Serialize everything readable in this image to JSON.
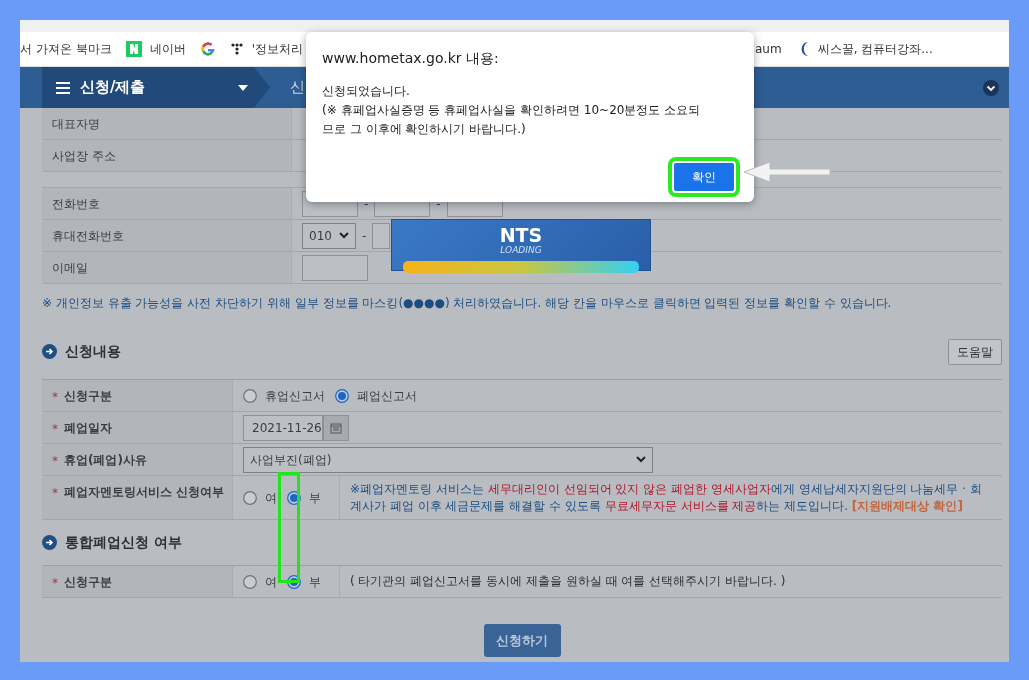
{
  "bookmarks_left": [
    {
      "kind": "text",
      "label": "서 가져온 북마크"
    },
    {
      "kind": "naver",
      "label": "네이버"
    },
    {
      "kind": "google"
    },
    {
      "kind": "dots",
      "label": "'정보처리"
    }
  ],
  "bookmarks_right": [
    {
      "kind": "text",
      "label": "aum"
    },
    {
      "kind": "crescent",
      "label": "씨스꿀, 컴퓨터강좌..."
    }
  ],
  "menu": {
    "title": "신청/제출",
    "breadcrumb": "신"
  },
  "dialog": {
    "title": "www.hometax.go.kr 내용:",
    "lines": [
      "신청되었습니다.",
      "(※ 휴페업사실증명 등 휴페업사실을 확인하려면 10~20분정도 소요되",
      "므로 그 이후에 확인하시기 바랍니다.)"
    ],
    "button": "확인"
  },
  "loading": {
    "title": "NTS",
    "subtitle": "LOADING"
  },
  "owner_rows": [
    {
      "label": "대표자명"
    },
    {
      "label": "사업장 주소"
    }
  ],
  "contact_rows": [
    {
      "label": "전화번호",
      "kind": "phone",
      "separator": "-"
    },
    {
      "label": "휴대전화번호",
      "kind": "mobile",
      "prefix": "010",
      "separator": "-"
    },
    {
      "label": "이메일",
      "kind": "email"
    }
  ],
  "notice": "※ 개인정보 유출 가능성을 사전 차단하기 위해 일부 정보를 마스킹(●●●●) 처리하였습니다. 해당 칸을 마우스로 클릭하면 입력된 정보를 확인할 수 있습니다.",
  "sections": [
    {
      "title": "신청내용",
      "help_button": "도움말",
      "rows": [
        {
          "mark": "*",
          "label": "신청구분",
          "kind": "radio",
          "options": [
            {
              "label": "휴업신고서",
              "selected": false
            },
            {
              "label": "폐업신고서",
              "selected": true
            }
          ]
        },
        {
          "mark": "*",
          "label": "폐업일자",
          "kind": "date",
          "value": "2021-11-26"
        },
        {
          "mark": "*",
          "label": "휴업(폐업)사유",
          "kind": "select",
          "value": "사업부진(폐업)"
        },
        {
          "mark": "*",
          "label": "폐업자멘토링서비스 신청여부",
          "kind": "radio-note",
          "options": [
            {
              "label": "여",
              "selected": false
            },
            {
              "label": "부",
              "selected": true
            }
          ],
          "note": [
            {
              "kind": "normal",
              "text": "※폐업자멘토링 서비스는 "
            },
            {
              "kind": "emphasis",
              "text": "세무대리인이 선임되어 있지 않은 폐업한 영세사업자"
            },
            {
              "kind": "normal",
              "text": "에게 영세납세자지원단의 나눔세무 · 회계사가 폐업 이후 세금문제를 해결할 수 있도록 "
            },
            {
              "kind": "emphasis",
              "text": "무료세무자문 서비스를 제공"
            },
            {
              "kind": "normal",
              "text": "하는 제도입니다. "
            },
            {
              "kind": "link",
              "text": "[지원배제대상 확인]"
            }
          ]
        }
      ]
    },
    {
      "title": "통합폐업신청 여부",
      "rows": [
        {
          "mark": "*",
          "label": "신청구분",
          "kind": "radio-note",
          "options": [
            {
              "label": "여",
              "selected": false
            },
            {
              "label": "부",
              "selected": true
            }
          ],
          "note": [
            {
              "kind": "plain",
              "text": "( 타기관의 폐업신고서를 동시에 제출을 원하실 때 여를 선택해주시기 바랍니다. )"
            }
          ]
        }
      ]
    }
  ],
  "submit_button": "신청하기"
}
